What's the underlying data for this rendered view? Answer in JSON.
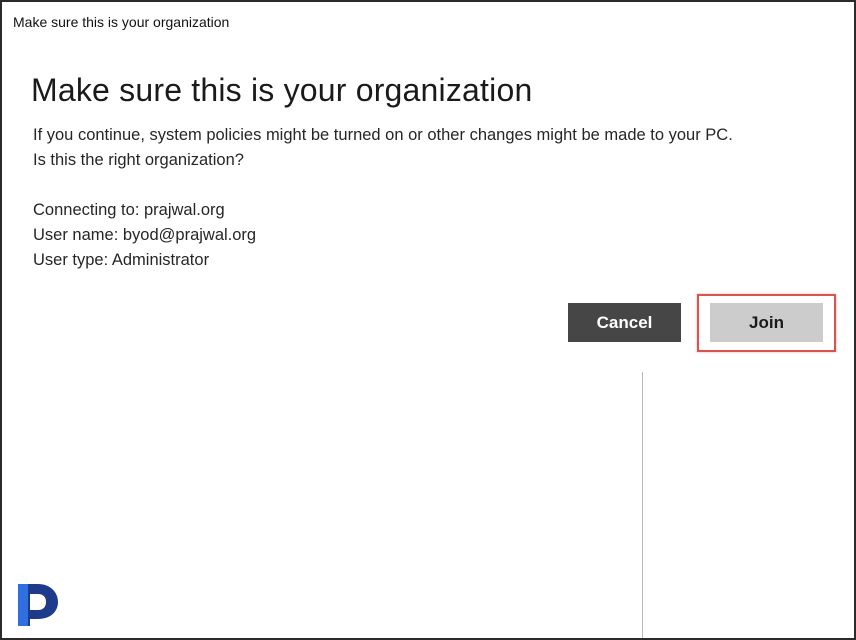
{
  "window": {
    "title": "Make sure this is your organization"
  },
  "dialog": {
    "heading": "Make sure this is your organization",
    "description_line1": "If you continue, system policies might be turned on or other changes might be made to your PC.",
    "description_line2": "Is this the right organization?",
    "connecting_to": "Connecting to: prajwal.org",
    "user_name": "User name: byod@prajwal.org",
    "user_type": "User type: Administrator"
  },
  "buttons": {
    "cancel_label": "Cancel",
    "join_label": "Join"
  },
  "colors": {
    "cancel_bg": "#464646",
    "join_bg": "#cccccc",
    "highlight": "#d9534f",
    "logo_primary": "#1e3a8a",
    "logo_secondary": "#2f6fe0"
  },
  "icons": {
    "logo": "prajwal-logo-icon"
  }
}
